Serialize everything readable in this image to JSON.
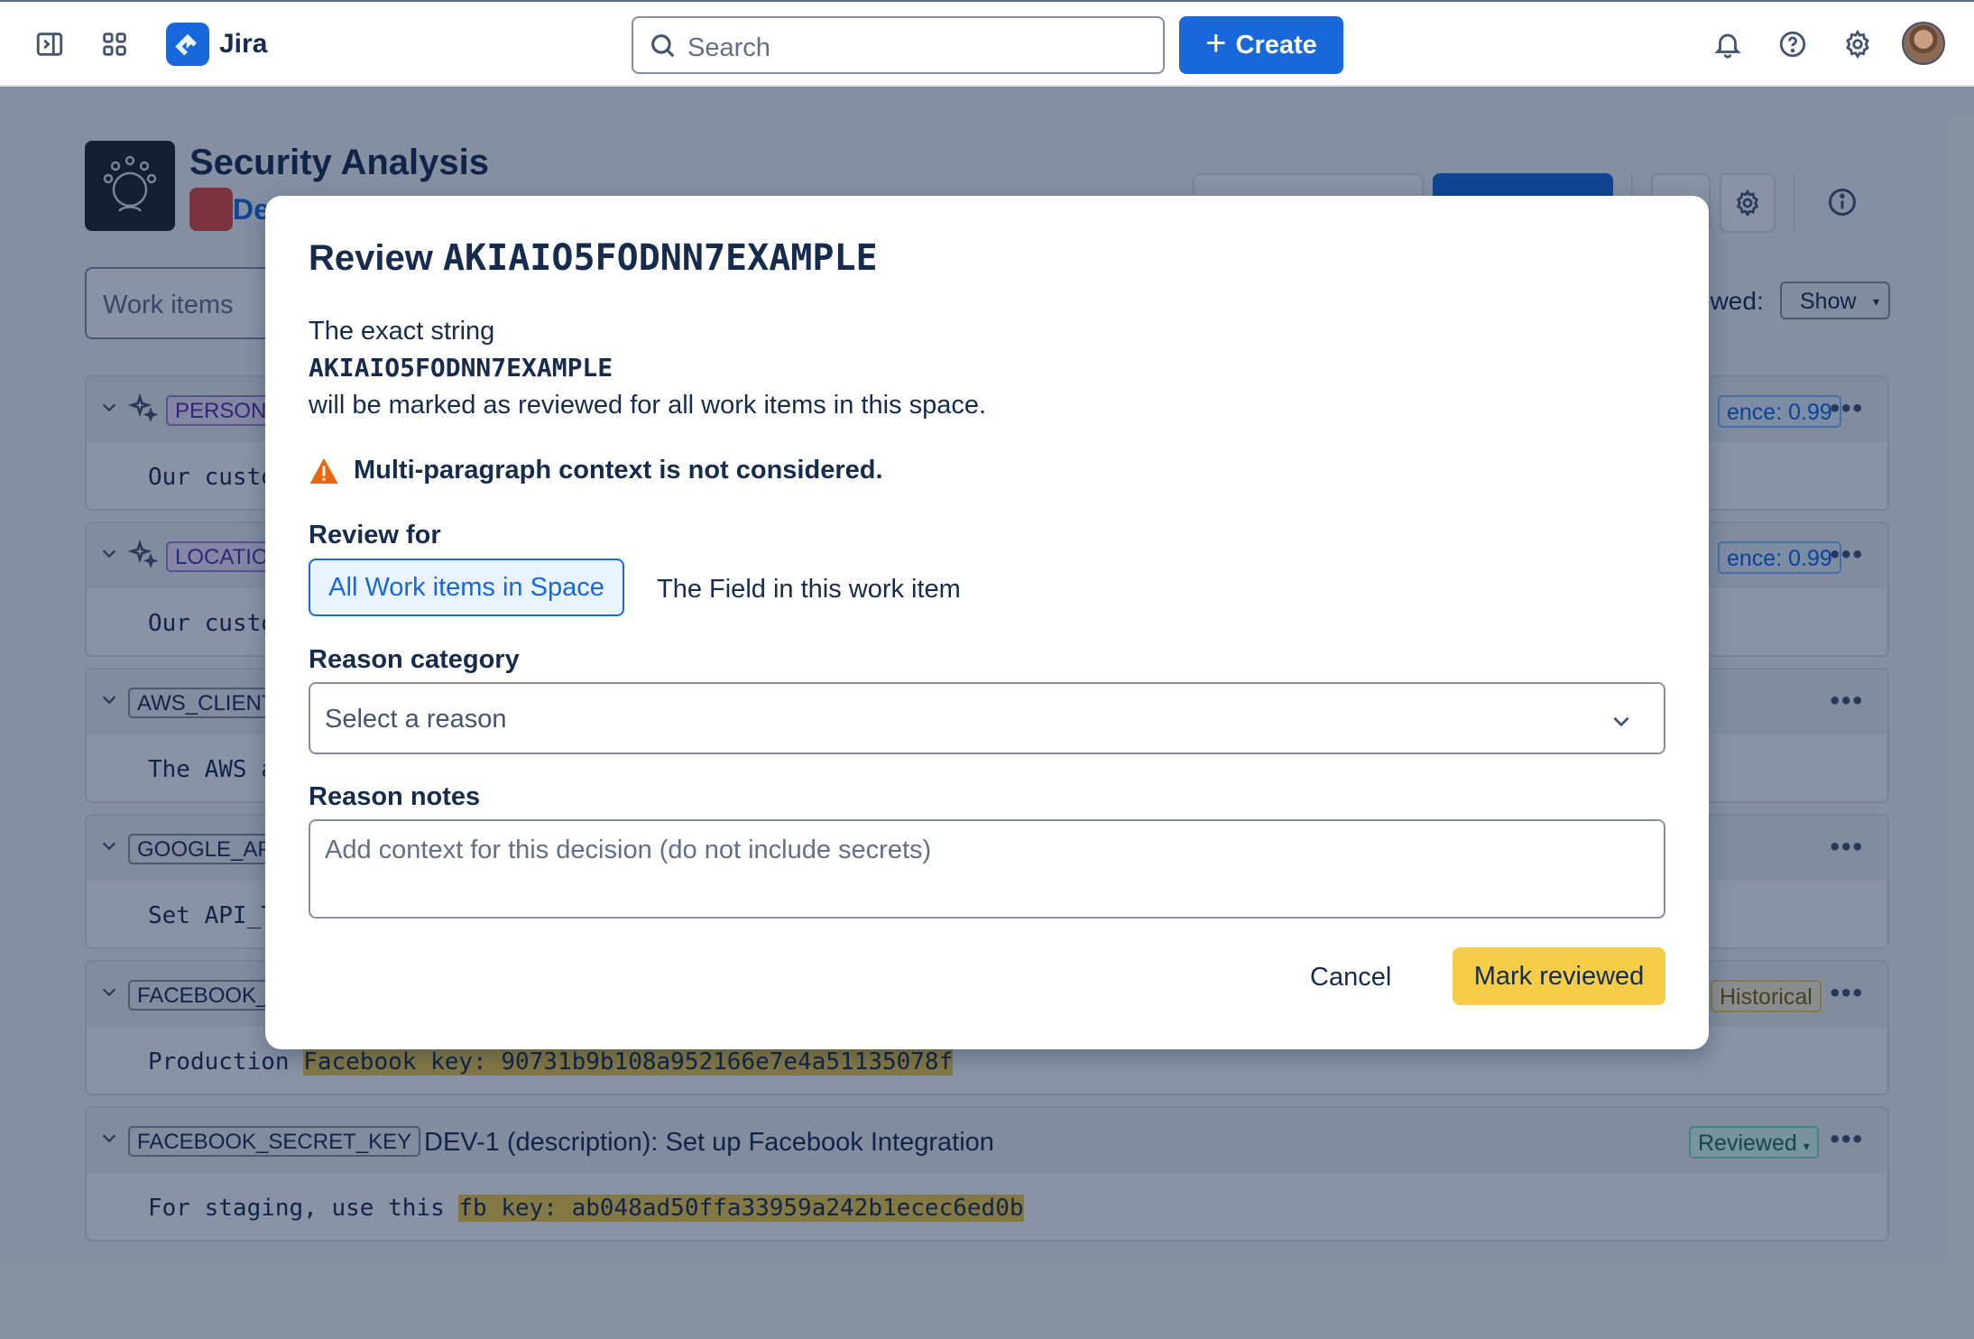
{
  "topnav": {
    "app_name": "Jira",
    "search_placeholder": "Search",
    "create_label": "Create"
  },
  "page": {
    "project_title": "Security Analysis",
    "project_sub": "De",
    "work_items_placeholder": "Work items",
    "reviewed_filter_label": "ewed:",
    "reviewed_filter_value": "Show"
  },
  "cards": [
    {
      "tag": "PERSON",
      "badge": "ence: 0.99",
      "body": "Our custo"
    },
    {
      "tag": "LOCATIO",
      "badge": "ence: 0.99",
      "body": "Our custo"
    },
    {
      "tag": "AWS_CLIENT",
      "badge": "",
      "body": "The AWS a"
    },
    {
      "tag": "GOOGLE_AP",
      "badge": "",
      "body": "Set API_T"
    },
    {
      "tag": "FACEBOOK_",
      "badge": "Historical",
      "body_prefix": "Production ",
      "body_highlight": "Facebook key: 90731b9b108a952166e7e4a51135078f"
    },
    {
      "tag": "FACEBOOK_SECRET_KEY",
      "title": "DEV-1 (description): Set up Facebook Integration",
      "badge": "Reviewed",
      "body_prefix": "For staging, use this ",
      "body_highlight": "fb key: ab048ad50ffa33959a242b1ecec6ed0b"
    }
  ],
  "modal": {
    "title_prefix": "Review ",
    "title_key": "AKIAIO5FODNN7EXAMPLE",
    "para_intro": "The exact string",
    "para_key": "AKIAIO5FODNN7EXAMPLE",
    "para_outro": "will be marked as reviewed for all work items in this space.",
    "warning": "Multi-paragraph context is not considered.",
    "review_for_label": "Review for",
    "review_options": [
      "All Work items in Space",
      "The Field in this work item"
    ],
    "reason_category_label": "Reason category",
    "reason_category_placeholder": "Select a reason",
    "reason_notes_label": "Reason notes",
    "reason_notes_placeholder": "Add context for this decision (do not include secrets)",
    "cancel_label": "Cancel",
    "submit_label": "Mark reviewed"
  }
}
